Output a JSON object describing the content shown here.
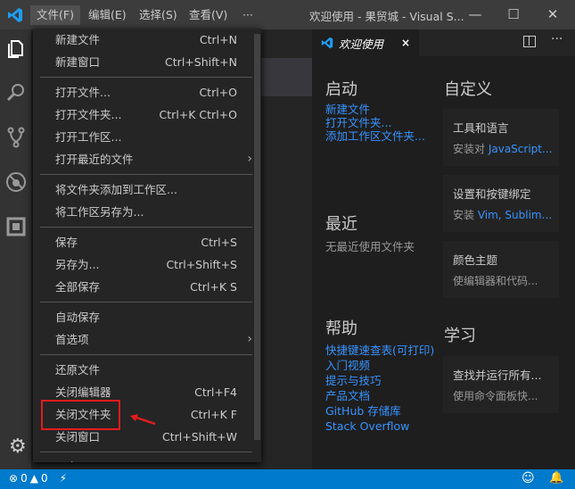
{
  "titlebar": {
    "menus": [
      "文件(F)",
      "编辑(E)",
      "选择(S)",
      "查看(V)",
      "···"
    ],
    "title": "欢迎使用 - 果贸城 - Visual S...",
    "min": "—",
    "max": "☐",
    "close": "✕"
  },
  "tab": {
    "label": "欢迎使用",
    "close": "×"
  },
  "file_menu": {
    "groups": [
      [
        {
          "label": "新建文件",
          "shortcut": "Ctrl+N"
        },
        {
          "label": "新建窗口",
          "shortcut": "Ctrl+Shift+N"
        }
      ],
      [
        {
          "label": "打开文件...",
          "shortcut": "Ctrl+O"
        },
        {
          "label": "打开文件夹...",
          "shortcut": "Ctrl+K Ctrl+O"
        },
        {
          "label": "打开工作区...",
          "shortcut": ""
        },
        {
          "label": "打开最近的文件",
          "shortcut": "",
          "submenu": true
        }
      ],
      [
        {
          "label": "将文件夹添加到工作区...",
          "shortcut": ""
        },
        {
          "label": "将工作区另存为...",
          "shortcut": ""
        }
      ],
      [
        {
          "label": "保存",
          "shortcut": "Ctrl+S"
        },
        {
          "label": "另存为...",
          "shortcut": "Ctrl+Shift+S"
        },
        {
          "label": "全部保存",
          "shortcut": "Ctrl+K S"
        }
      ],
      [
        {
          "label": "自动保存",
          "shortcut": ""
        },
        {
          "label": "首选项",
          "shortcut": "",
          "submenu": true
        }
      ],
      [
        {
          "label": "还原文件",
          "shortcut": ""
        },
        {
          "label": "关闭编辑器",
          "shortcut": "Ctrl+F4"
        },
        {
          "label": "关闭文件夹",
          "shortcut": "Ctrl+K F",
          "highlighted": true
        },
        {
          "label": "关闭窗口",
          "shortcut": "Ctrl+Shift+W"
        }
      ],
      [
        {
          "label": "退出",
          "shortcut": ""
        }
      ]
    ]
  },
  "welcome": {
    "start": {
      "title": "启动",
      "links": [
        "新建文件",
        "打开文件夹...",
        "添加工作区文件夹..."
      ]
    },
    "recent": {
      "title": "最近",
      "empty": "无最近使用文件夹"
    },
    "help": {
      "title": "帮助",
      "links": [
        "快捷键速查表(可打印)",
        "入门视频",
        "提示与技巧",
        "产品文档",
        "GitHub 存储库",
        "Stack Overflow"
      ]
    },
    "customize": {
      "title": "自定义",
      "cards": [
        {
          "title": "工具和语言",
          "prefix": "安装对 ",
          "link": "JavaScript..."
        },
        {
          "title": "设置和按键绑定",
          "prefix": "安装 ",
          "link": "Vim, Sublim..."
        },
        {
          "title": "颜色主题",
          "prefix": "使编辑器和代码...",
          "link": ""
        }
      ]
    },
    "learn": {
      "title": "学习",
      "cards": [
        {
          "title": "查找并运行所有...",
          "prefix": "使用命令面板快...",
          "link": ""
        }
      ]
    }
  },
  "status": {
    "errors": "0",
    "warnings": "0"
  },
  "colors": {
    "accent": "#007acc",
    "link": "#3794ff",
    "highlight": "#e51b1b"
  }
}
